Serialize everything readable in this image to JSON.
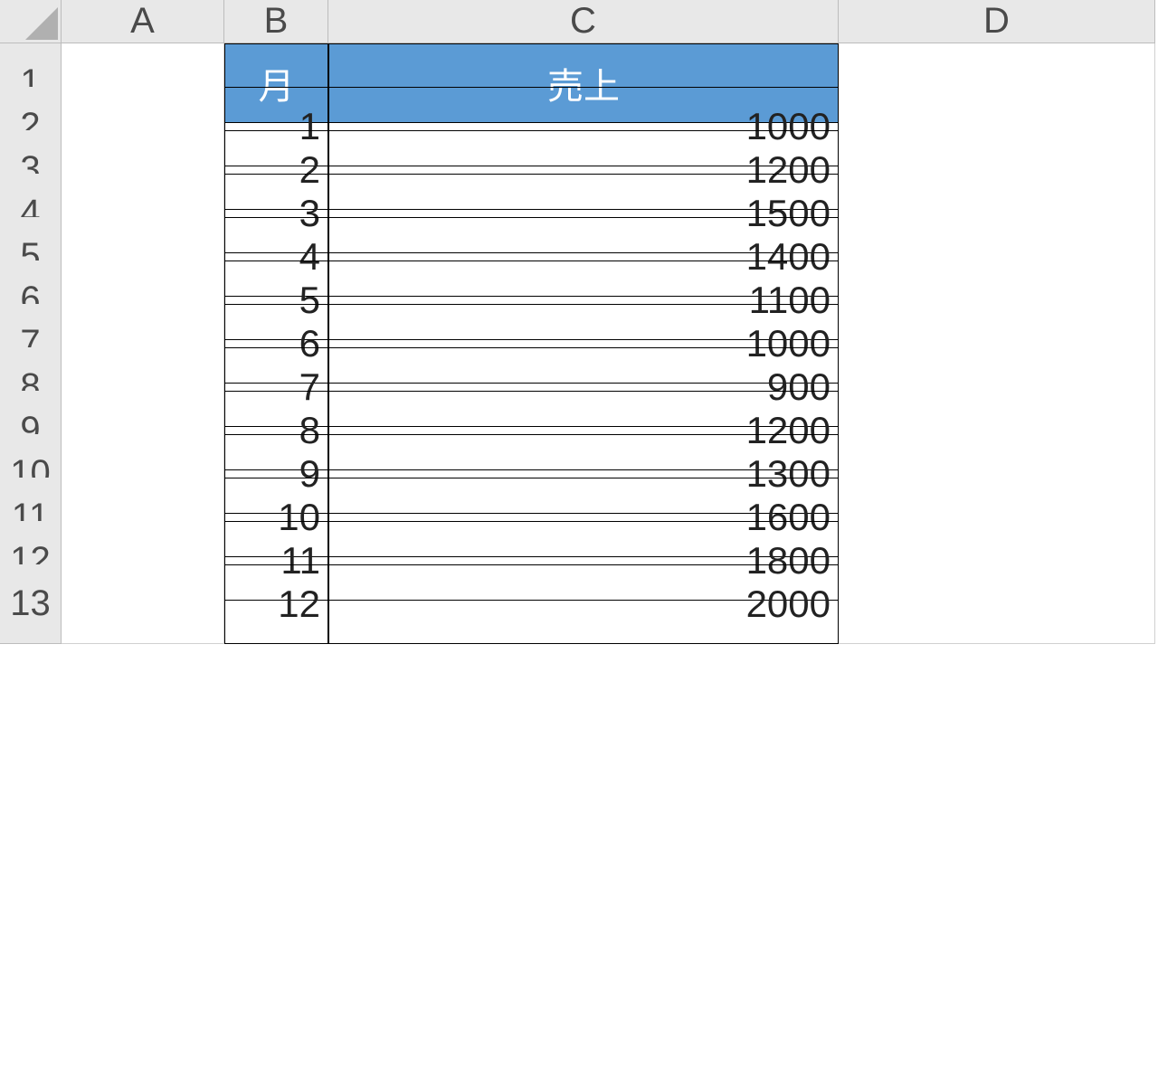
{
  "columns": [
    "A",
    "B",
    "C",
    "D"
  ],
  "row_numbers": [
    1,
    2,
    3,
    4,
    5,
    6,
    7,
    8,
    9,
    10,
    11,
    12,
    13
  ],
  "table": {
    "headers": {
      "b": "月",
      "c": "売上"
    },
    "rows": [
      {
        "month": 1,
        "sales": 1000
      },
      {
        "month": 2,
        "sales": 1200
      },
      {
        "month": 3,
        "sales": 1500
      },
      {
        "month": 4,
        "sales": 1400
      },
      {
        "month": 5,
        "sales": 1100
      },
      {
        "month": 6,
        "sales": 1000
      },
      {
        "month": 7,
        "sales": 900
      },
      {
        "month": 8,
        "sales": 1200
      },
      {
        "month": 9,
        "sales": 1300
      },
      {
        "month": 10,
        "sales": 1600
      },
      {
        "month": 11,
        "sales": 1800
      },
      {
        "month": 12,
        "sales": 2000
      }
    ]
  }
}
